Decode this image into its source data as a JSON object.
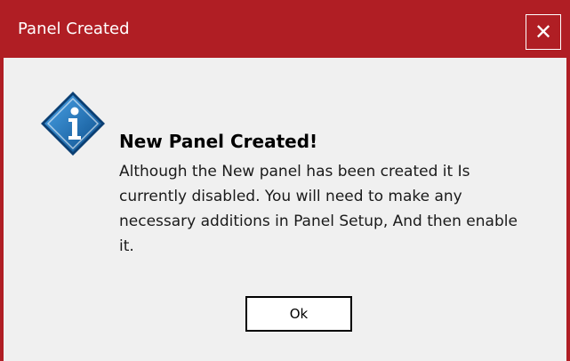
{
  "window": {
    "title": "Panel Created",
    "close_symbol": "✕"
  },
  "dialog": {
    "icon": "info-icon",
    "heading": "New Panel Created!",
    "message": "Although the New panel has been created it Is currently disabled. You will need to make any necessary additions in Panel Setup, And then enable it.",
    "ok_label": "Ok"
  },
  "colors": {
    "titlebar": "#b01e24",
    "background": "#f0f0f0",
    "icon_blue": "#1f6fb5"
  }
}
